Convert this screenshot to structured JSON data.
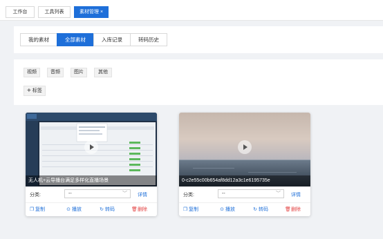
{
  "tabs": [
    {
      "label": "工作台",
      "active": false
    },
    {
      "label": "工具列表",
      "active": false
    },
    {
      "label": "素材管理",
      "active": true,
      "close": "×"
    }
  ],
  "segments": [
    {
      "label": "我的素材",
      "active": false
    },
    {
      "label": "全部素材",
      "active": true
    },
    {
      "label": "入库记录",
      "active": false
    },
    {
      "label": "转码历史",
      "active": false
    }
  ],
  "types": [
    "视频",
    "音频",
    "图片",
    "其他"
  ],
  "tag_button": {
    "icon": "+",
    "label": "标签"
  },
  "cards": [
    {
      "title": "无人机+云导播台满足多样化直播场景",
      "category_label": "分类:",
      "category_value": "--",
      "detail": "详情",
      "actions": {
        "copy": "复制",
        "play": "播放",
        "transcode": "转码",
        "delete": "删除"
      }
    },
    {
      "title": "0-c2e55c00b654af8dd12a3c1e6195735e",
      "category_label": "分类:",
      "category_value": "--",
      "detail": "详情",
      "actions": {
        "copy": "复制",
        "play": "播放",
        "transcode": "转码",
        "delete": "删除"
      }
    }
  ],
  "colors": {
    "primary": "#1e6fd9",
    "danger": "#e34242",
    "page_bg": "#f0f2f5"
  }
}
